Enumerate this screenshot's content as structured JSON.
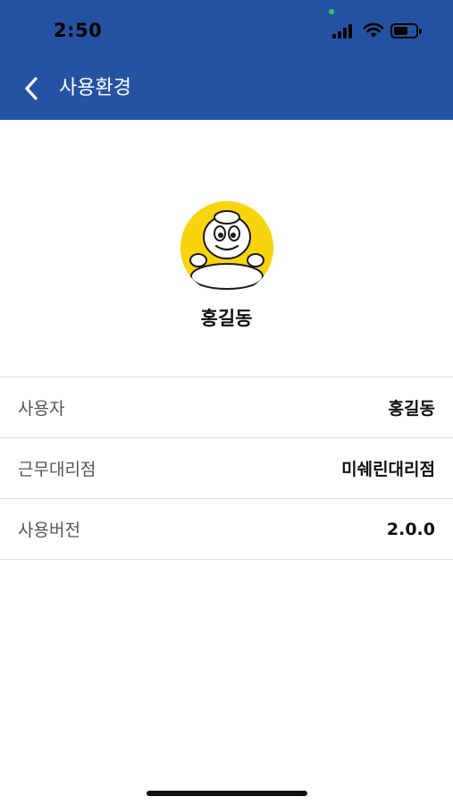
{
  "status_bar": {
    "time": "2:50"
  },
  "nav": {
    "title": "사용환경",
    "back_icon": "chevron-left-icon"
  },
  "profile": {
    "avatar_icon": "michelin-bibendum-avatar",
    "name": "홍길동"
  },
  "info": [
    {
      "label": "사용자",
      "value": "홍길동"
    },
    {
      "label": "근무대리점",
      "value": "미쉐린대리점"
    },
    {
      "label": "사용버전",
      "value": "2.0.0"
    }
  ],
  "colors": {
    "header": "#2453a3",
    "avatar_bg": "#f8d40f",
    "divider": "#dcdcdc"
  }
}
